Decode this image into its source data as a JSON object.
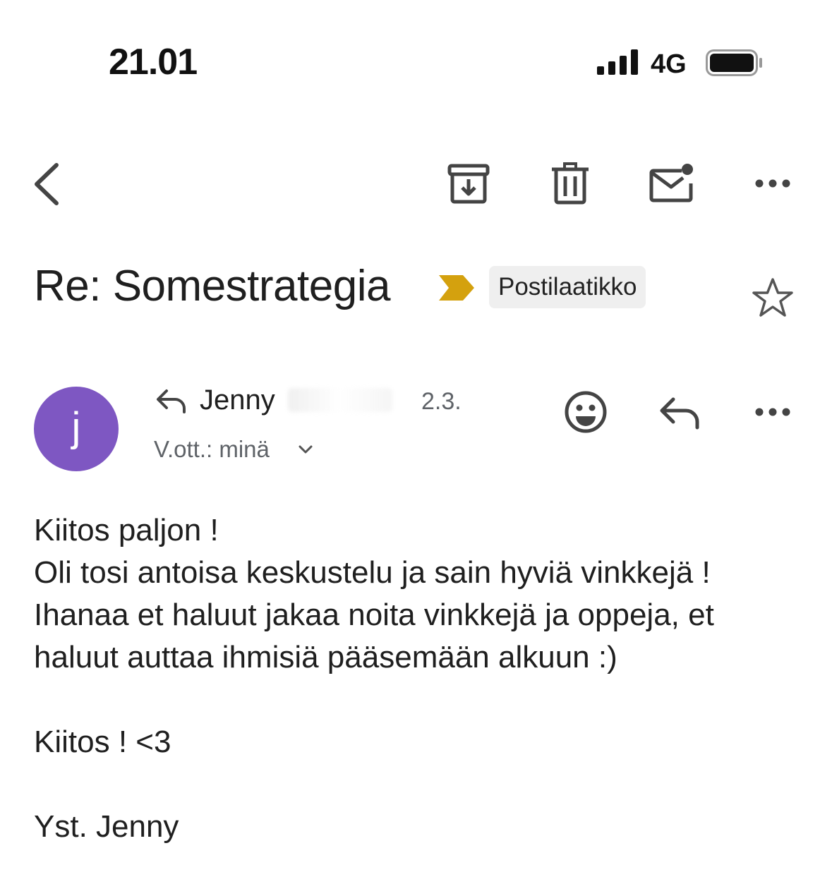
{
  "status_bar": {
    "time": "21.01",
    "network": "4G"
  },
  "toolbar": {
    "icons": [
      "back-icon",
      "archive-icon",
      "trash-icon",
      "mark-unread-icon",
      "more-icon"
    ]
  },
  "email": {
    "subject": "Re: Somestrategia",
    "label": "Postilaatikko",
    "importance_color": "#d4a10e",
    "sender": {
      "initial": "j",
      "name": "Jenny",
      "avatar_color": "#7e57c2",
      "date": "2.3.",
      "recipient": "V.ott.: minä"
    },
    "body": {
      "line1": "Kiitos paljon !",
      "line2": "Oli tosi antoisa keskustelu ja sain hyviä vinkkejä !",
      "line3": "Ihanaa et haluut jakaa noita vinkkejä ja oppeja, et",
      "line4": "haluut auttaa ihmisiä pääsemään alkuun :)",
      "line5": "Kiitos ! <3",
      "line6": "Yst. Jenny"
    }
  }
}
